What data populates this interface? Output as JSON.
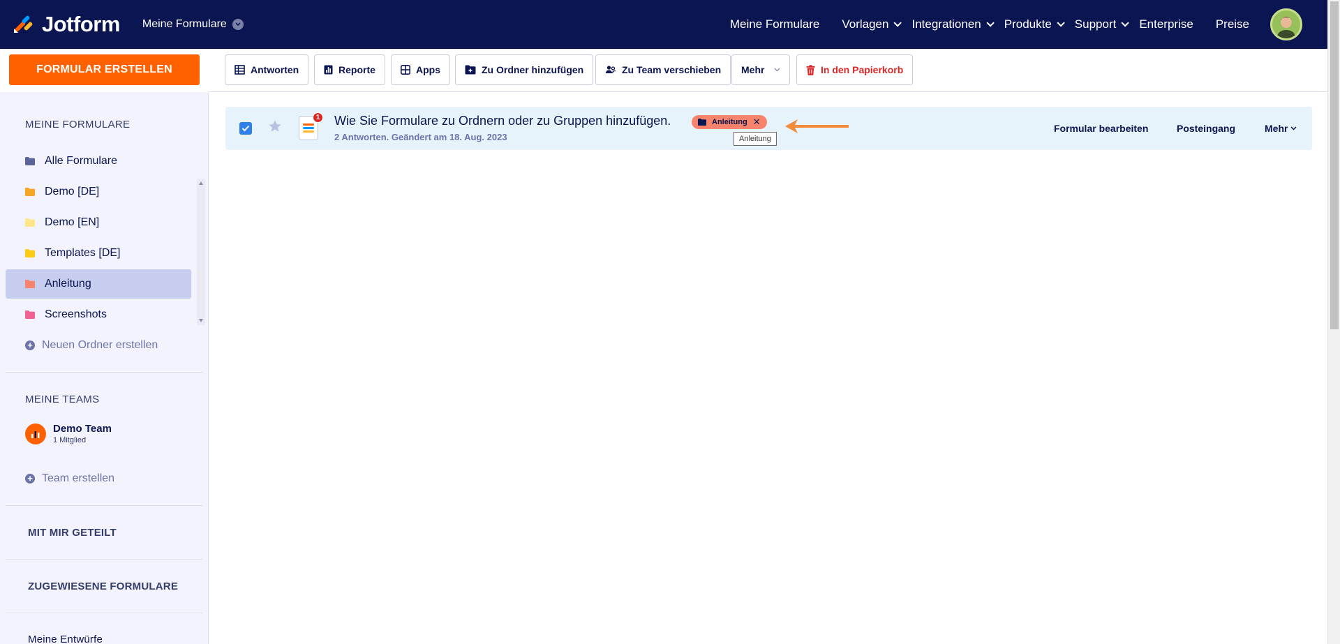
{
  "app": {
    "logo_text": "Jotform",
    "myforms_toggle": "Meine Formulare"
  },
  "nav": {
    "items": [
      {
        "label": "Meine Formulare",
        "dropdown": false
      },
      {
        "label": "Vorlagen",
        "dropdown": true
      },
      {
        "label": "Integrationen",
        "dropdown": true
      },
      {
        "label": "Produkte",
        "dropdown": true
      },
      {
        "label": "Support",
        "dropdown": true
      },
      {
        "label": "Enterprise",
        "dropdown": false
      },
      {
        "label": "Preise",
        "dropdown": false
      }
    ]
  },
  "create_button": "FORMULAR ERSTELLEN",
  "toolbar": {
    "responses": "Antworten",
    "reports": "Reporte",
    "apps": "Apps",
    "add_to_folder": "Zu Ordner hinzufügen",
    "move_to_team": "Zu Team verschieben",
    "more": "Mehr",
    "trash": "In den Papierkorb"
  },
  "sidebar": {
    "my_forms_heading": "MEINE FORMULARE",
    "folders": [
      {
        "label": "Alle Formulare",
        "color": "#5c6599"
      },
      {
        "label": "Demo [DE]",
        "color": "#f5a623"
      },
      {
        "label": "Demo [EN]",
        "color": "#fde68a"
      },
      {
        "label": "Templates [DE]",
        "color": "#facc15"
      },
      {
        "label": "Anleitung",
        "color": "#f6836b",
        "active": true
      },
      {
        "label": "Screenshots",
        "color": "#f06292"
      }
    ],
    "new_folder": "Neuen Ordner erstellen",
    "my_teams_heading": "MEINE TEAMS",
    "team": {
      "name": "Demo Team",
      "members": "1 Mitglied"
    },
    "create_team": "Team erstellen",
    "shared_with_me": "MIT MIR GETEILT",
    "assigned_forms": "ZUGEWIESENE FORMULARE",
    "drafts": "Meine Entwürfe"
  },
  "form": {
    "title": "Wie Sie Formulare zu Ordnern oder zu Gruppen hinzufügen.",
    "meta": "2 Antworten. Geändert am 18. Aug. 2023",
    "badge_count": "1",
    "tag": "Anleitung",
    "tooltip": "Anleitung",
    "edit": "Formular bearbeiten",
    "inbox": "Posteingang",
    "more": "Mehr"
  },
  "colors": {
    "navy": "#0a1551",
    "orange": "#ff6100",
    "row_bg": "#e7f3fb",
    "danger": "#dc2626",
    "annotation_arrow": "#f28b3b"
  }
}
